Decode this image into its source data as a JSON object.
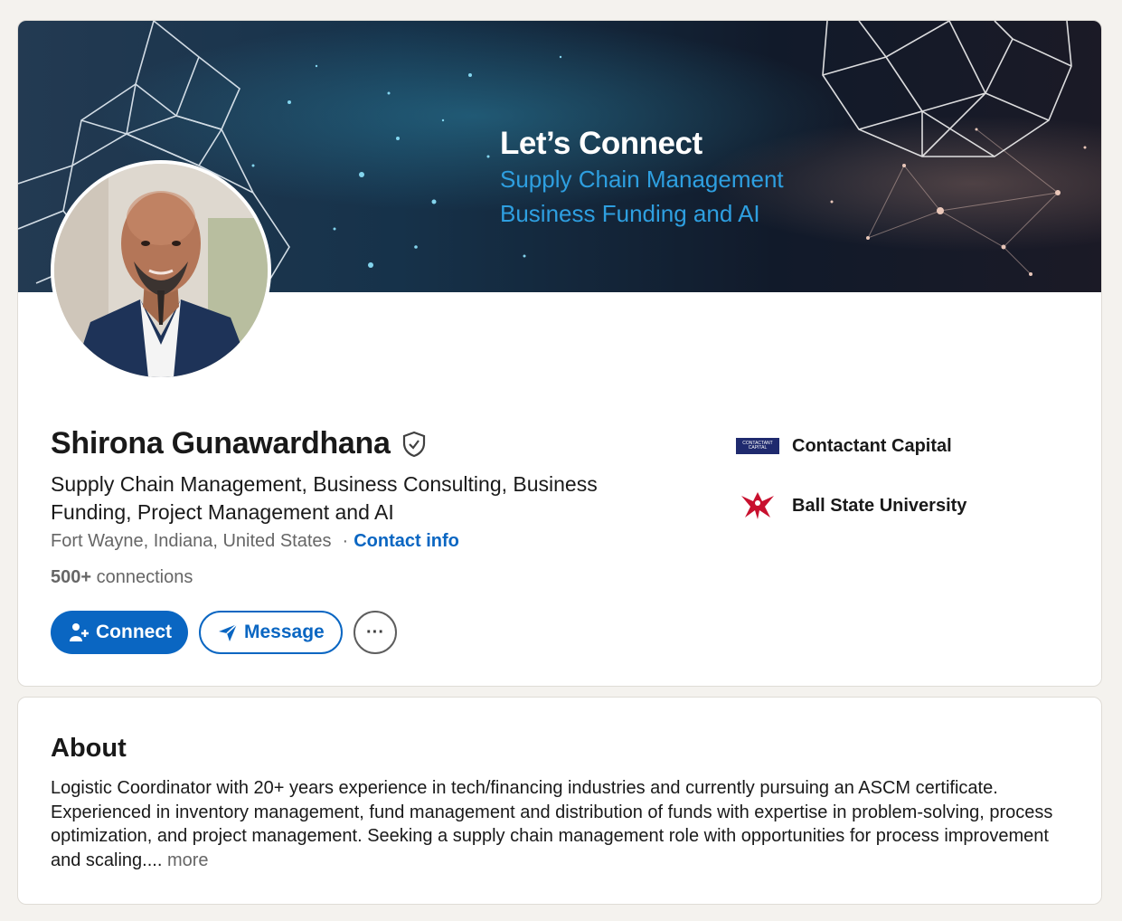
{
  "banner": {
    "headline": "Let’s Connect",
    "subline_1": "Supply Chain Management",
    "subline_2": "Business Funding and AI"
  },
  "profile": {
    "name": "Shirona Gunawardhana",
    "verified_icon": "shield-check-icon",
    "headline": "Supply Chain Management, Business Consulting, Business Funding, Project Management and AI",
    "location": "Fort Wayne, Indiana, United States",
    "separator": "·",
    "contact_info_label": "Contact info",
    "connections_count": "500+",
    "connections_label": "connections"
  },
  "actions": {
    "connect_label": "Connect",
    "message_label": "Message",
    "more_label": "···"
  },
  "organizations": [
    {
      "name": "Contactant Capital",
      "logo_text": "CONTACTANT CAPITAL",
      "icon": "company-logo"
    },
    {
      "name": "Ball State University",
      "icon": "cardinal-logo"
    }
  ],
  "about": {
    "title": "About",
    "text": "Logistic Coordinator with 20+ years experience in tech/financing industries and currently pursuing an ASCM certificate. Experienced in  inventory management, fund management and distribution of funds with expertise in problem-solving, process optimization, and project management. Seeking a supply chain management role with opportunities for process improvement and scaling....",
    "more_label": "more"
  },
  "colors": {
    "brand_blue": "#0a66c2",
    "banner_dark": "#0f1c2e",
    "banner_accent": "#2e9fe0",
    "page_bg": "#f4f2ee"
  }
}
